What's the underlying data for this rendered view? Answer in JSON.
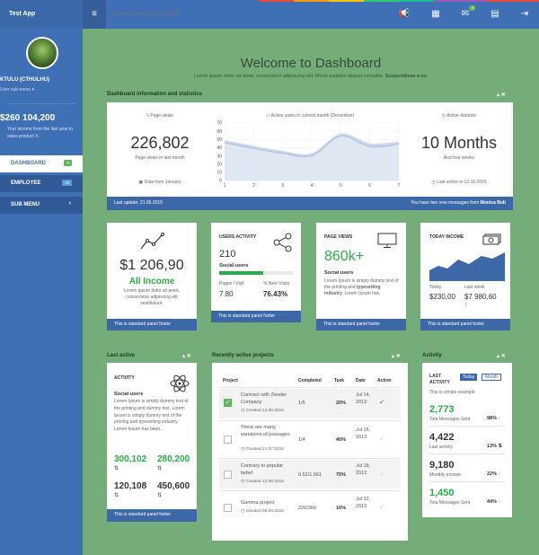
{
  "app": {
    "title": "Test App"
  },
  "topbar": {
    "search_placeholder": "Search something special",
    "mail_count": "4"
  },
  "sidebar": {
    "username": "KTULU (CTHULHU)",
    "user_menu": "User sub-menu",
    "income": "$260 104,200",
    "income_desc": "Your income from the last year in sales product X.",
    "items": [
      {
        "label": "DASHBOARD",
        "badge": "7"
      },
      {
        "label": "EMPLOYEE",
        "badge": "+2"
      },
      {
        "label": "SUB MENU"
      }
    ]
  },
  "header": {
    "title": "Welcome to Dashboard",
    "subtitle": "Lorem ipsum dolor sit amet, consectetur adipiscing elit. Morbi sodales aliquet convallis.",
    "subtitle_bold": "Suspendisse a ex."
  },
  "stats": {
    "title": "Dashboard information and statistics",
    "page_views_label": "Page views",
    "page_views": "226,802",
    "page_views_desc": "Page views in last month",
    "page_views_note": "Data from January",
    "chart_label": "Active users in current month (December)",
    "duration_label": "Active duration",
    "duration": "10 Months",
    "duration_desc": "And four weeks",
    "duration_note": "Last active in 12.10.2015",
    "footer_left": "Last update: 21.05.2015",
    "footer_right": "You have two new messages from",
    "footer_name": "Monica Bolt"
  },
  "chart_data": {
    "type": "area",
    "x": [
      1,
      2,
      3,
      4,
      5,
      6,
      7
    ],
    "xlim": [
      1,
      7
    ],
    "ylim": [
      0,
      70
    ],
    "yticks": [
      0,
      10,
      20,
      30,
      40,
      50,
      60,
      70
    ],
    "series": [
      {
        "values": [
          46,
          39,
          33,
          30,
          54,
          41,
          44
        ]
      },
      {
        "values": [
          49,
          42,
          36,
          33,
          57,
          45,
          47
        ]
      }
    ]
  },
  "income_panel": {
    "value": "$1 206,90",
    "label": "All Income",
    "desc": "Lorem ipsum dolor sit amet, consectetur adipiscing elit vestibulum.",
    "footer": "This is standard panel footer"
  },
  "users_panel": {
    "title": "USERS ACTIVITY",
    "value": "210",
    "label": "Social users",
    "progress": 0.6,
    "col1": "Pages / Visit",
    "col2": "% New Visits",
    "v1": "7.80",
    "v2": "76.43%",
    "footer": "This is standard panel footer"
  },
  "views_panel": {
    "title": "PAGE VIEWS",
    "value": "860k+",
    "label": "Social users",
    "desc_pre": "Lorem Ipsum is simply dummy text of the printing and",
    "desc_bold": "typesetting industry",
    "desc_post": ". Lorem Ipsum has.",
    "footer": "This is standard panel footer"
  },
  "today_panel": {
    "title": "TODAY INCOME",
    "col1": "Today",
    "col2": "Last week",
    "v1": "$230,00",
    "v2": "$7 980,60",
    "footer": "This is standard panel footer"
  },
  "last_active": {
    "title": "Last active",
    "heading": "ACTIVITY",
    "label": "Social users",
    "desc": "Lorem Ipsum is simply dummy text of the printing and dummy text. Lorem Ipsum is simply dummy text of the printing and typesetting industry. Lorem Ipsum has been.",
    "n1": "300,102",
    "n2": "280,200",
    "n3": "120,108",
    "n4": "450,600",
    "footer": "This is standard panel footer"
  },
  "projects": {
    "title": "Recently active projects",
    "headers": [
      "Project",
      "Completed",
      "Task",
      "Date",
      "Action"
    ],
    "rows": [
      {
        "name": "Contract with Zender Company",
        "created": "Created 14.08.2015",
        "completed": "1/5",
        "task": "20%",
        "date": "Jul 14, 2013"
      },
      {
        "name": "There are many variations of passages",
        "created": "Created 21.07.2015",
        "completed": "1/4",
        "task": "40%",
        "date": "Jul 16, 2013"
      },
      {
        "name": "Contrary to popular belief",
        "created": "Created 12.06.2015",
        "completed": "0.52/1.561",
        "task": "75%",
        "date": "Jul 18, 2013"
      },
      {
        "name": "Gamma project",
        "created": "Created 06.03.2015",
        "completed": "226/360",
        "task": "16%",
        "date": "Jul 22, 2013"
      }
    ]
  },
  "activity": {
    "title": "Activity",
    "heading": "LAST ACTIVITY",
    "tab1": "Today",
    "tab2": "Month",
    "example": "This is simple example",
    "items": [
      {
        "value": "2,773",
        "label": "Tota Messages Sent",
        "pct": "98%"
      },
      {
        "value": "4,422",
        "label": "Last activity",
        "pct": "13%"
      },
      {
        "value": "9,180",
        "label": "Monthly income",
        "pct": "22%"
      },
      {
        "value": "1,450",
        "label": "Tota Messages Sent",
        "pct": "44%"
      }
    ]
  }
}
